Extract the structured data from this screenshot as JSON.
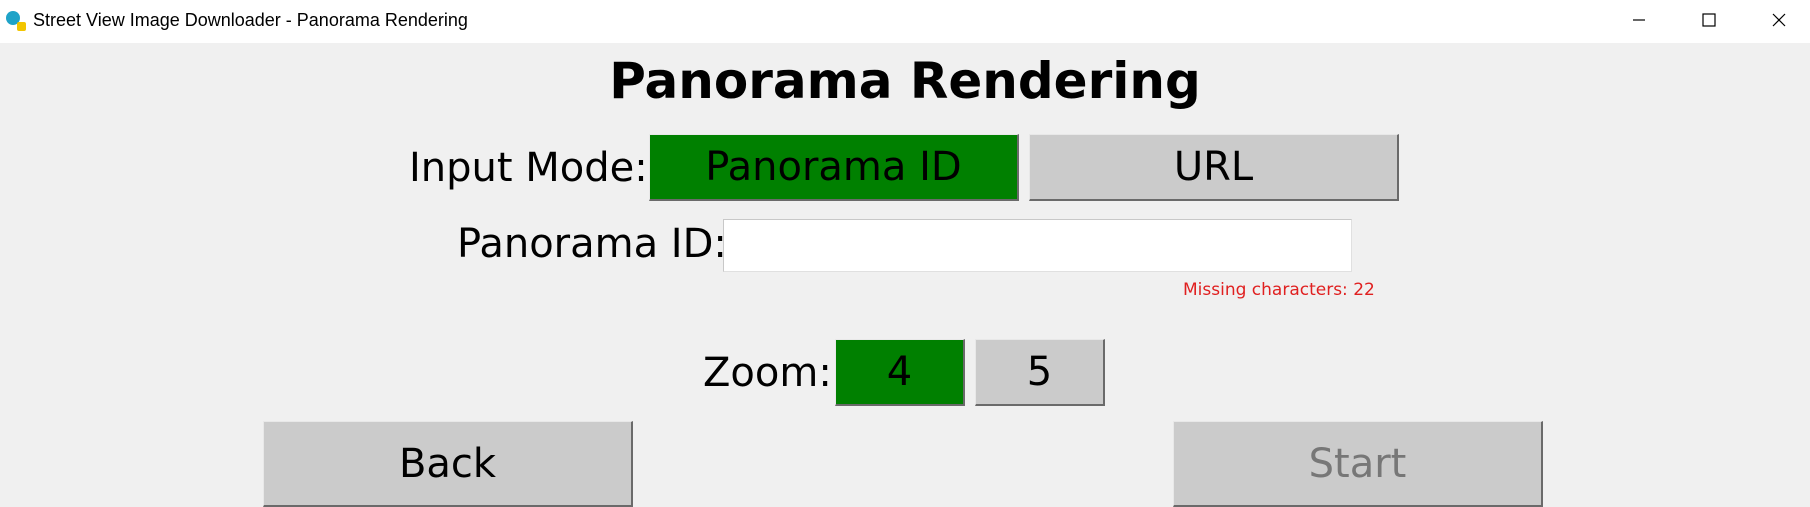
{
  "window": {
    "title": "Street View Image Downloader - Panorama Rendering",
    "controls": {
      "minimize": "minimize-icon",
      "maximize": "maximize-icon",
      "close": "close-icon"
    }
  },
  "heading": "Panorama Rendering",
  "input_mode": {
    "label": "Input Mode:",
    "options": [
      "Panorama ID",
      "URL"
    ],
    "selected": "Panorama ID"
  },
  "panorama_id": {
    "label": "Panorama ID:",
    "value": "",
    "warning": "Missing characters: 22"
  },
  "zoom": {
    "label": "Zoom:",
    "options": [
      "4",
      "5"
    ],
    "selected": "4"
  },
  "actions": {
    "back_label": "Back",
    "start_label": "Start"
  },
  "colors": {
    "selected": "#008000",
    "unselected": "#cbcbcb",
    "warning": "#e02020",
    "background": "#f0f0f0"
  }
}
